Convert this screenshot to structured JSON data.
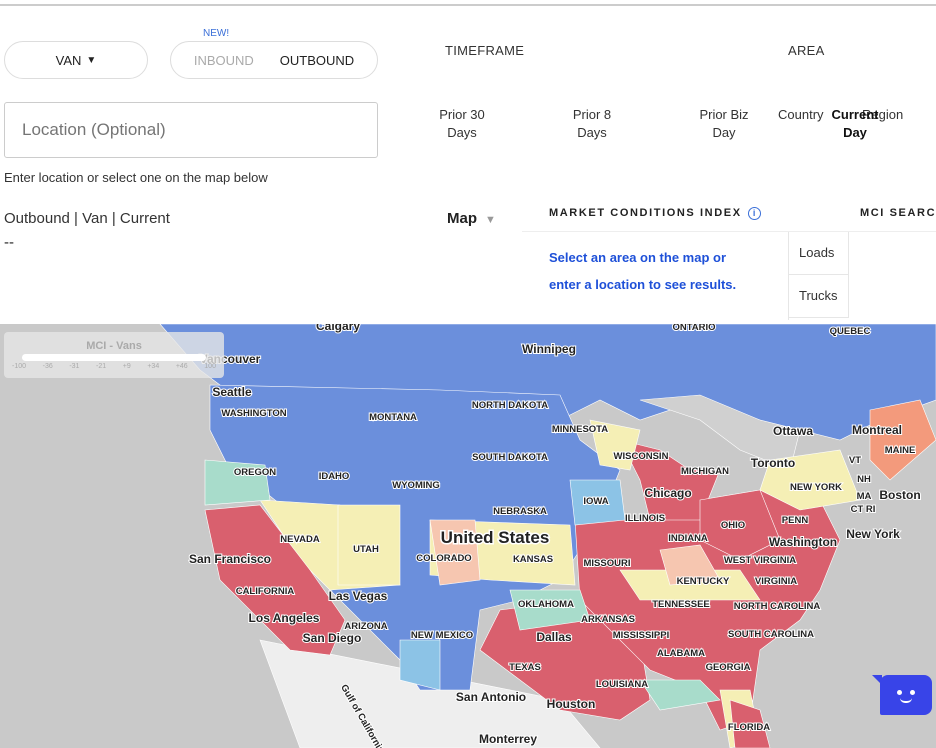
{
  "controls": {
    "equipment": "VAN",
    "new_badge": "NEW!",
    "inbound": "INBOUND",
    "outbound": "OUTBOUND",
    "location_placeholder": "Location (Optional)",
    "location_hint": "Enter location or select one on the map below"
  },
  "timeframe": {
    "header": "TIMEFRAME",
    "options": [
      {
        "line1": "Prior 30",
        "line2": "Days"
      },
      {
        "line1": "Prior 8",
        "line2": "Days"
      },
      {
        "line1": "Prior Biz",
        "line2": "Day"
      },
      {
        "line1": "Current",
        "line2": "Day",
        "selected": true
      }
    ]
  },
  "area": {
    "header": "AREA",
    "options": [
      "Country",
      "Region"
    ]
  },
  "selection": {
    "summary": "Outbound | Van | Current",
    "value": "--",
    "view": "Map"
  },
  "mci": {
    "title": "MARKET CONDITIONS INDEX",
    "search_title": "MCI SEARCH",
    "message_line1": "Select an area on the map or",
    "message_line2": "enter a location to see results.",
    "rows": [
      "Loads",
      "Trucks"
    ]
  },
  "legend": {
    "title": "MCI - Vans",
    "ticks": [
      "-100",
      "-36",
      "-31",
      "-21",
      "+9",
      "+34",
      "+46",
      "100"
    ]
  },
  "colors": {
    "accent": "#1e50d8",
    "very_low": "#6b8fdc",
    "low": "#8cc3e6",
    "mid_low": "#a8dccb",
    "neutral": "#f5efb5",
    "mid_high": "#f6c6b0",
    "high": "#f39a7c",
    "very_high": "#d9606e"
  },
  "map_labels": [
    "Calgary",
    "ONTARIO",
    "QUEBEC",
    "Winnipeg",
    "Vancouver",
    "Seattle",
    "WASHINGTON",
    "MONTANA",
    "NORTH DAKOTA",
    "MINNESOTA",
    "Ottawa",
    "Montreal",
    "MAINE",
    "OREGON",
    "IDAHO",
    "SOUTH DAKOTA",
    "WISCONSIN",
    "MICHIGAN",
    "Toronto",
    "VT",
    "NH",
    "MA",
    "Boston",
    "CT RI",
    "NEW YORK",
    "WYOMING",
    "IOWA",
    "Chicago",
    "NEBRASKA",
    "ILLINOIS",
    "OHIO",
    "PENN",
    "New York",
    "NEVADA",
    "UTAH",
    "COLORADO",
    "United States",
    "KANSAS",
    "MISSOURI",
    "INDIANA",
    "Washington",
    "WEST VIRGINIA",
    "VIRGINIA",
    "KENTUCKY",
    "San Francisco",
    "CALIFORNIA",
    "Las Vegas",
    "Los Angeles",
    "ARIZONA",
    "San Diego",
    "NEW MEXICO",
    "OKLAHOMA",
    "ARKANSAS",
    "TENNESSEE",
    "NORTH CAROLINA",
    "SOUTH CAROLINA",
    "Dallas",
    "MISSISSIPPI",
    "ALABAMA",
    "GEORGIA",
    "TEXAS",
    "LOUISIANA",
    "San Antonio",
    "Houston",
    "FLORIDA",
    "Monterrey",
    "Gulf of California"
  ]
}
